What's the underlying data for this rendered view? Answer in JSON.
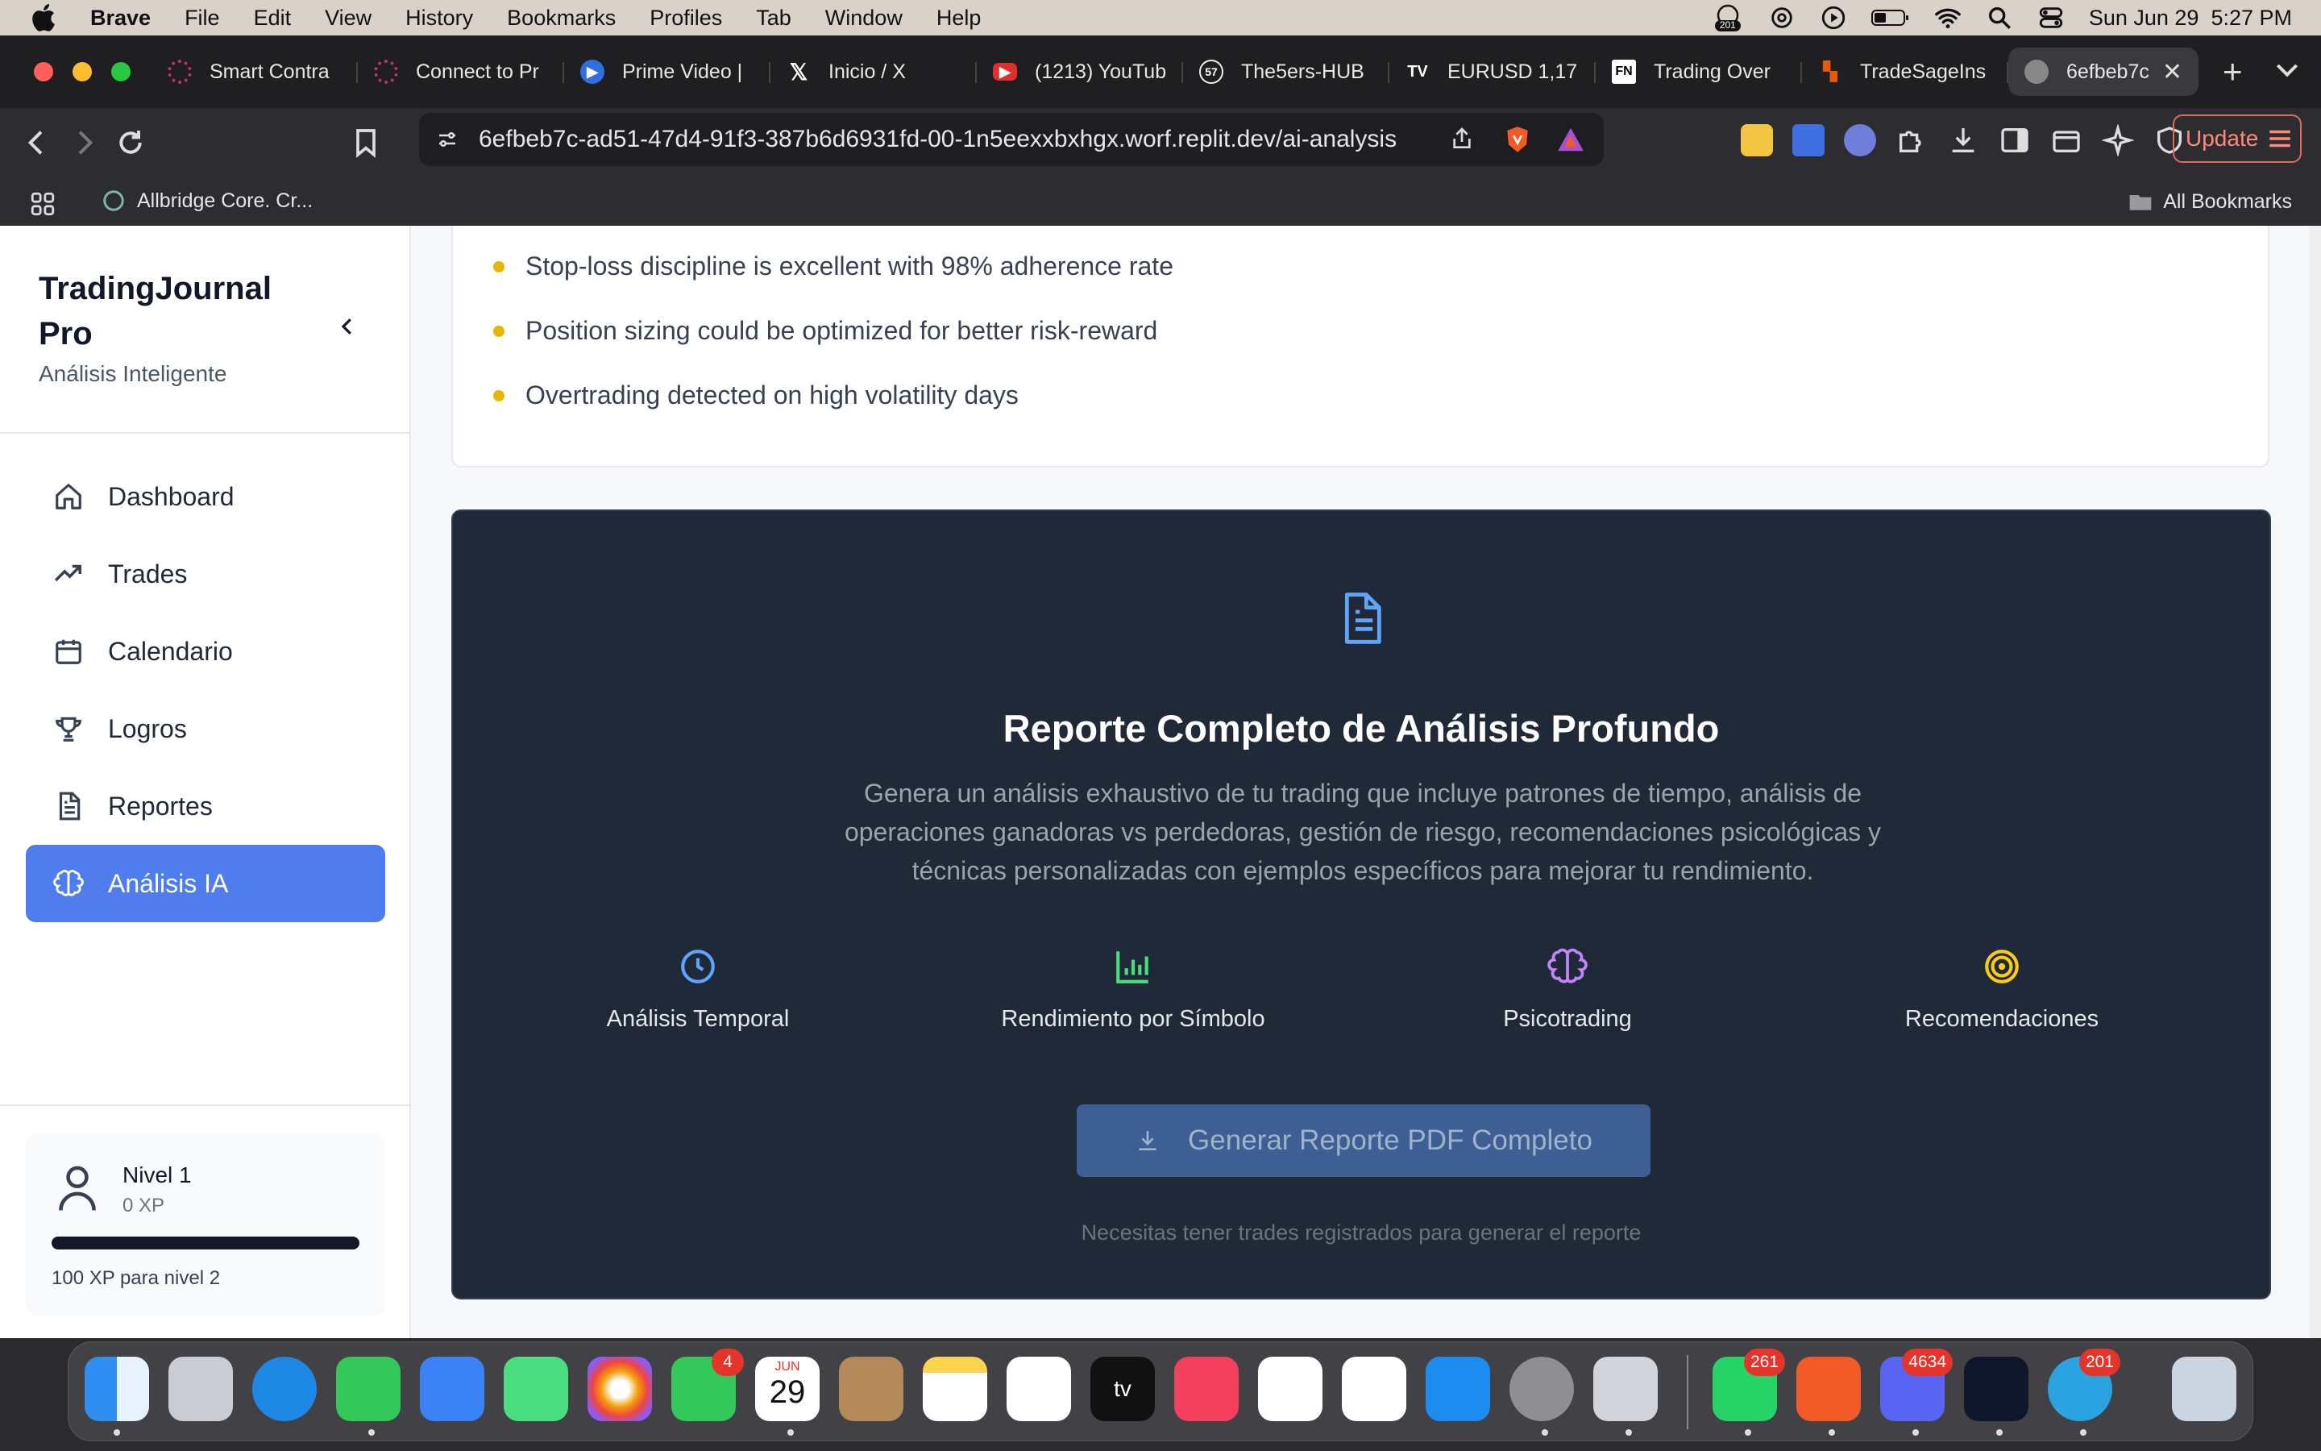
{
  "menubar": {
    "app": "Brave",
    "items": [
      "File",
      "Edit",
      "View",
      "History",
      "Bookmarks",
      "Profiles",
      "Tab",
      "Window",
      "Help"
    ],
    "notif_badge": "201",
    "datetime": "Sun Jun 29  5:27 PM"
  },
  "tabs": [
    {
      "title": "Smart Contra",
      "icon_color": "#c0306a"
    },
    {
      "title": "Connect to Pr",
      "icon_color": "#c0306a"
    },
    {
      "title": "Prime Video |",
      "icon_color": "#2f6fe0"
    },
    {
      "title": "Inicio / X",
      "icon_color": "#000000"
    },
    {
      "title": "(1213) YouTub",
      "icon_color": "#e02f2f"
    },
    {
      "title": "The5ers-HUB",
      "icon_color": "#37b24d"
    },
    {
      "title": "EURUSD 1,17",
      "icon_color": "#000000"
    },
    {
      "title": "Trading Over",
      "icon_color": "#ffffff"
    },
    {
      "title": "TradeSageIns",
      "icon_color": "#e8590c"
    },
    {
      "title": "6efbeb7c",
      "icon_color": "#888888",
      "active": true
    }
  ],
  "toolbar": {
    "url": "6efbeb7c-ad51-47d4-91f3-387b6d6931fd-00-1n5eexxbxhgx.worf.replit.dev/ai-analysis",
    "update_label": "Update"
  },
  "bookmarks": {
    "item": "Allbridge Core. Cr...",
    "all": "All Bookmarks"
  },
  "sidebar": {
    "brand": "TradingJournal Pro",
    "subtitle": "Análisis Inteligente",
    "items": [
      {
        "label": "Dashboard",
        "icon": "home-icon"
      },
      {
        "label": "Trades",
        "icon": "trending-up-icon"
      },
      {
        "label": "Calendario",
        "icon": "calendar-icon"
      },
      {
        "label": "Logros",
        "icon": "trophy-icon"
      },
      {
        "label": "Reportes",
        "icon": "file-text-icon"
      },
      {
        "label": "Análisis IA",
        "icon": "brain-icon",
        "active": true
      }
    ],
    "level": {
      "title": "Nivel 1",
      "xp": "0 XP",
      "progress": 0,
      "next": "100 XP para nivel 2"
    }
  },
  "insights": [
    "Stop-loss discipline is excellent with 98% adherence rate",
    "Position sizing could be optimized for better risk-reward",
    "Overtrading detected on high volatility days"
  ],
  "report": {
    "title": "Reporte Completo de Análisis Profundo",
    "description": "Genera un análisis exhaustivo de tu trading que incluye patrones de tiempo, análisis de operaciones ganadoras vs perdedoras, gestión de riesgo, recomendaciones psicológicas y técnicas personalizadas con ejemplos específicos para mejorar tu rendimiento.",
    "features": [
      {
        "label": "Análisis Temporal",
        "icon": "clock-icon",
        "color": "#60a5fa"
      },
      {
        "label": "Rendimiento por Símbolo",
        "icon": "bar-chart-icon",
        "color": "#4ade80"
      },
      {
        "label": "Psicotrading",
        "icon": "brain-icon",
        "color": "#c084fc"
      },
      {
        "label": "Recomendaciones",
        "icon": "target-icon",
        "color": "#facc15"
      }
    ],
    "button": "Generar Reporte PDF Completo",
    "note": "Necesitas tener trades registrados para generar el reporte"
  },
  "dock": {
    "badges": {
      "facetime": "4",
      "calendar_month": "JUN",
      "calendar_day": "29",
      "whatsapp": "261",
      "discord": "4634",
      "telegram": "201"
    }
  }
}
